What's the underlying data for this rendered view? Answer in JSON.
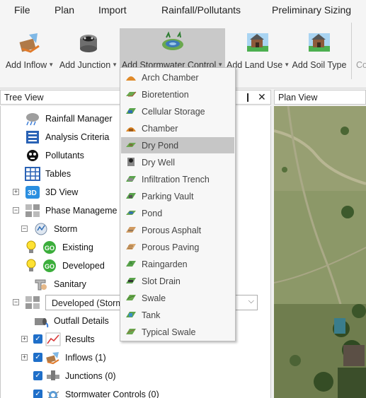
{
  "menu": [
    "File",
    "Plan",
    "Import",
    "Rainfall/Pollutants",
    "Preliminary Sizing"
  ],
  "ribbon": {
    "add_inflow": "Add Inflow",
    "add_junction": "Add Junction",
    "add_stormwater_control": "Add Stormwater Control",
    "add_land_use": "Add Land Use",
    "add_soil_type": "Add Soil Type",
    "cut_label": "Co"
  },
  "tree_view": {
    "title": "Tree View",
    "pin_glyph": "❙",
    "close_glyph": "✕",
    "items": {
      "rainfall_manager": "Rainfall Manager",
      "analysis_criteria": "Analysis Criteria",
      "pollutants": "Pollutants",
      "tables": "Tables",
      "view_3d": "3D View",
      "phase_management": "Phase Manageme",
      "storm": "Storm",
      "existing": "Existing",
      "developed": "Developed",
      "sanitary": "Sanitary",
      "phase_combo": "Developed (Storm",
      "outfall_details": "Outfall Details",
      "results": "Results",
      "inflows": "Inflows (1)",
      "junctions": "Junctions (0)",
      "stormwater_controls": "Stormwater Controls (0)"
    },
    "go_badge": "GO"
  },
  "plan_view": {
    "title": "Plan View"
  },
  "dropdown": {
    "items": [
      "Arch Chamber",
      "Bioretention",
      "Cellular Storage",
      "Chamber",
      "Dry Pond",
      "Dry Well",
      "Infiltration Trench",
      "Parking Vault",
      "Pond",
      "Porous Asphalt",
      "Porous Paving",
      "Raingarden",
      "Slot Drain",
      "Swale",
      "Tank",
      "Typical Swale"
    ],
    "highlighted": "Dry Pond"
  },
  "colors": {
    "highlight": "#c6c6c6",
    "checkbox": "#1f6fc9",
    "go_green": "#3cae3c",
    "ribbon_active": "#c9c9c9"
  }
}
